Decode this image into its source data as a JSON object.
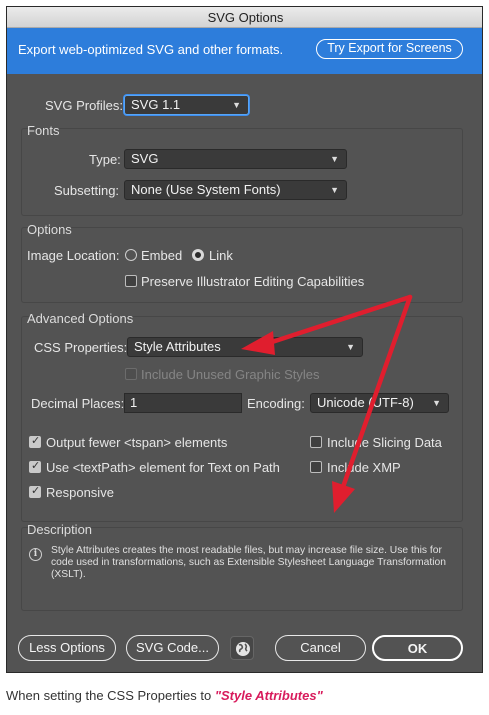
{
  "window": {
    "title": "SVG Options"
  },
  "banner": {
    "text": "Export web-optimized SVG and other formats.",
    "button_label": "Try Export for Screens"
  },
  "svg_profiles": {
    "label": "SVG Profiles:",
    "value": "SVG 1.1"
  },
  "fonts": {
    "title": "Fonts",
    "type_label": "Type:",
    "type_value": "SVG",
    "subsetting_label": "Subsetting:",
    "subsetting_value": "None (Use System Fonts)"
  },
  "options": {
    "title": "Options",
    "image_location_label": "Image Location:",
    "embed_label": "Embed",
    "embed_selected": false,
    "link_label": "Link",
    "link_selected": true,
    "preserve_label": "Preserve Illustrator Editing Capabilities",
    "preserve_checked": false
  },
  "advanced": {
    "title": "Advanced Options",
    "css_label": "CSS Properties:",
    "css_value": "Style Attributes",
    "include_unused_label": "Include Unused Graphic Styles",
    "decimal_label": "Decimal Places:",
    "decimal_value": "1",
    "encoding_label": "Encoding:",
    "encoding_value": "Unicode (UTF-8)",
    "tspan_label": "Output fewer <tspan> elements",
    "tspan_checked": true,
    "slicing_label": "Include Slicing Data",
    "slicing_checked": false,
    "textpath_label": "Use <textPath> element for Text on Path",
    "textpath_checked": true,
    "xmp_label": "Include XMP",
    "xmp_checked": false,
    "responsive_label": "Responsive",
    "responsive_checked": true
  },
  "description": {
    "title": "Description",
    "text": "Style Attributes creates the most readable files, but may increase file size. Use this for code used in transformations, such as Extensible Stylesheet Language Transformation (XSLT)."
  },
  "buttons": {
    "less_options": "Less Options",
    "svg_code": "SVG Code...",
    "cancel": "Cancel",
    "ok": "OK"
  },
  "caption": {
    "prefix": "When setting the CSS Properties to ",
    "highlight": "\"Style Attributes\""
  },
  "colors": {
    "dialog_bg": "#535353",
    "banner": "#2d7ddb",
    "annotation_arrow": "#e01e2e",
    "caption_highlight": "#d81b5c"
  }
}
